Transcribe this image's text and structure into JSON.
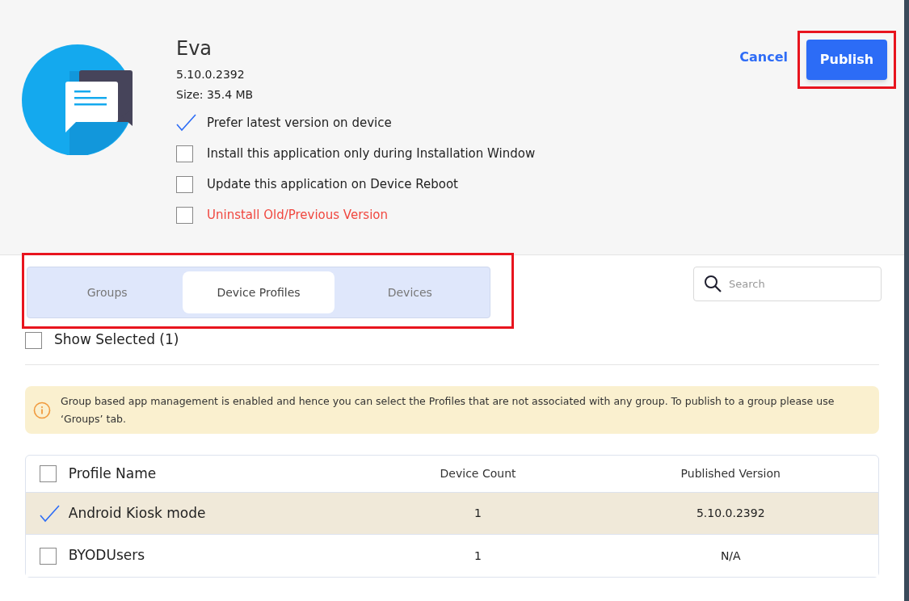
{
  "app": {
    "name": "Eva",
    "version": "5.10.0.2392",
    "size": "Size: 35.4 MB"
  },
  "options": [
    {
      "label": "Prefer latest version on device",
      "checked": true,
      "warning": false
    },
    {
      "label": "Install this application only during Installation Window",
      "checked": false,
      "warning": false
    },
    {
      "label": "Update this application on Device Reboot",
      "checked": false,
      "warning": false
    },
    {
      "label": "Uninstall Old/Previous Version",
      "checked": false,
      "warning": true
    }
  ],
  "actions": {
    "cancel": "Cancel",
    "publish": "Publish",
    "publish_highlighted": true
  },
  "tabs": {
    "highlighted": true,
    "items": [
      {
        "label": "Groups",
        "selected": false
      },
      {
        "label": "Device Profiles",
        "selected": true
      },
      {
        "label": "Devices",
        "selected": false
      }
    ]
  },
  "search": {
    "placeholder": "Search"
  },
  "show_selected": {
    "label": "Show Selected (1)",
    "checked": false
  },
  "notice": "Group based app management is enabled and hence you can select the Profiles that are not associated with any group. To publish to a group please use ‘Groups’ tab.",
  "table": {
    "columns": [
      "Profile Name",
      "Device Count",
      "Published Version"
    ],
    "all_checked": false,
    "rows": [
      {
        "cells": [
          "Android Kiosk mode",
          "1",
          "5.10.0.2392"
        ],
        "selected": true
      },
      {
        "cells": [
          "BYODUsers",
          "1",
          "N/A"
        ],
        "selected": false
      }
    ]
  }
}
